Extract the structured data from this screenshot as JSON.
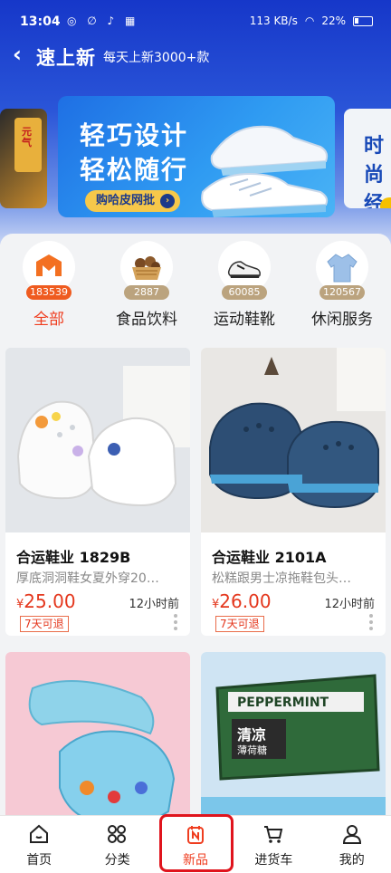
{
  "status": {
    "time": "13:04",
    "signal": "113 KB/s",
    "battery": "22%"
  },
  "header": {
    "back_icon": "chevron-left-icon",
    "title": "速上新",
    "subtitle": "每天上新3000+款"
  },
  "banner": {
    "line1": "轻巧设计",
    "line2": "轻松随行",
    "button": "购哈皮网批",
    "left_snack_text": "元气",
    "right_text": "时尚经典"
  },
  "categories": [
    {
      "label": "全部",
      "count": "183539",
      "icon": "brand-m-icon",
      "active": true
    },
    {
      "label": "食品饮料",
      "count": "2887",
      "icon": "food-basket-icon",
      "active": false
    },
    {
      "label": "运动鞋靴",
      "count": "60085",
      "icon": "sneaker-icon",
      "active": false
    },
    {
      "label": "休闲服务",
      "count": "120567",
      "icon": "shirt-icon",
      "active": false
    }
  ],
  "products": [
    {
      "name": "合运鞋业  1829B",
      "desc": "厚底洞洞鞋女夏外穿20…",
      "price_symbol": "¥",
      "price": "25.00",
      "time": "12小时前",
      "tag": "7天可退"
    },
    {
      "name": "合运鞋业  2101A",
      "desc": "松糕跟男士凉拖鞋包头…",
      "price_symbol": "¥",
      "price": "26.00",
      "time": "12小时前",
      "tag": "7天可退"
    },
    {
      "name": "",
      "desc": "",
      "price": "",
      "time": "",
      "tag": ""
    },
    {
      "name": "",
      "desc": "",
      "price": "",
      "time": "",
      "tag": "",
      "pack_brand": "PEPPERMINT",
      "pack_cn": "清凉",
      "pack_sub": "薄荷糖"
    }
  ],
  "tabs": [
    {
      "label": "首页",
      "icon": "home-icon"
    },
    {
      "label": "分类",
      "icon": "category-icon"
    },
    {
      "label": "新品",
      "icon": "new-products-icon",
      "active": true
    },
    {
      "label": "进货车",
      "icon": "cart-icon"
    },
    {
      "label": "我的",
      "icon": "user-icon"
    }
  ],
  "colors": {
    "accent": "#ef3d1f",
    "header_blue": "#1637c9",
    "badge": "#bba37e"
  }
}
